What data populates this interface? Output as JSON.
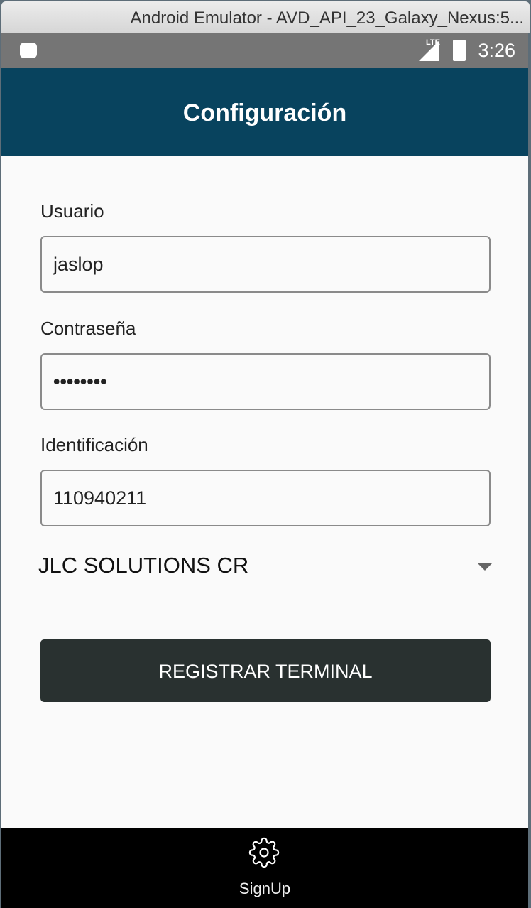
{
  "window": {
    "title": "Android Emulator - AVD_API_23_Galaxy_Nexus:5..."
  },
  "status_bar": {
    "network": "LTE",
    "time": "3:26"
  },
  "app_bar": {
    "title": "Configuración"
  },
  "form": {
    "usuario_label": "Usuario",
    "usuario_value": "jaslop",
    "password_label": "Contraseña",
    "password_value": "••••••••",
    "id_label": "Identificación",
    "id_value": "110940211",
    "company_selected": "JLC SOLUTIONS CR",
    "submit_label": "REGISTRAR TERMINAL"
  },
  "tab_bar": {
    "items": [
      {
        "label": "SignUp",
        "icon": "gear-icon"
      }
    ]
  }
}
